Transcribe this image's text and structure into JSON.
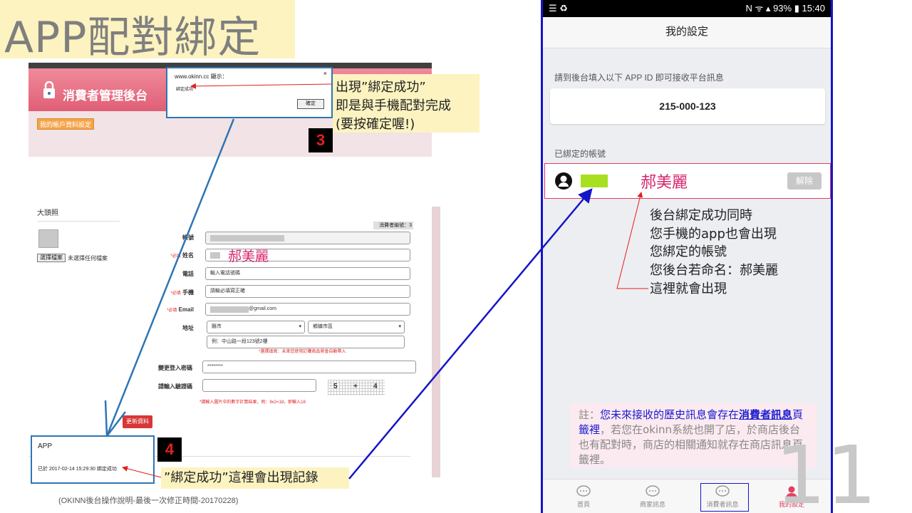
{
  "slide": {
    "title": "APP配對綁定",
    "page_number": "11",
    "footer_note": "(OKINN後台操作說明-最後一次修正時間-20170228)"
  },
  "backend": {
    "header_title": "消費者管理後台",
    "account_button": "我的帳戶資料設定",
    "dialog": {
      "host": "www.okinn.cc 顯示：",
      "message": "綁定成功",
      "close": "×",
      "ok_button": "確定"
    },
    "form": {
      "avatar_label": "大頭照",
      "file_button": "選擇檔案",
      "file_status": "未選擇任何檔案",
      "consumer_no": "消費者編號：3",
      "required_tag": "*必填",
      "fields": {
        "account_label": "帳號",
        "name_label": "姓名",
        "name_value": "郝美麗",
        "phone_label": "電話",
        "phone_placeholder": "輸入電話號碼",
        "mobile_label": "手機",
        "mobile_placeholder": "請輸必填寫正確",
        "email_label": "Email",
        "email_value": "@gmail.com",
        "address_label": "地址",
        "city_value": "縣市",
        "district_value": "鄉鎮市區",
        "street_placeholder": "例：中山路一段123號2樓",
        "address_hint": "*選擇填寫：未來您使用訂購商品將會自動帶入",
        "password_label": "變更登入密碼",
        "password_value": "********",
        "captcha_label": "請輸入驗證碼",
        "captcha_a": "5",
        "captcha_op": "+",
        "captcha_b": "4",
        "captcha_hint": "*請輸入圖片中的數字計算結果，例：9x2=18，即輸入18"
      },
      "update_button": "更新資料"
    },
    "app_box": {
      "title": "APP",
      "log": "已於 2017-02-14 15:29:30 綁定成功"
    }
  },
  "callouts": {
    "dialog_lines": [
      "出現”綁定成功”",
      "即是與手機配對完成",
      "(要按確定喔!)"
    ],
    "step3": "3",
    "step4": "4",
    "record": "”綁定成功”這裡會出現記錄"
  },
  "phone": {
    "status_left": "☰ ♻",
    "status_right": "N ᯤ ▴ 93% ▮ 15:40",
    "app_bar_title": "我的設定",
    "appid_prompt": "請到後台填入以下 APP ID 即可接收平台訊息",
    "app_id": "215-000-123",
    "bound_label": "已綁定的帳號",
    "bound_name": "郝美麗",
    "unbind_button": "解除",
    "explain_lines": [
      "後台綁定成功同時",
      "您手機的app也會出現",
      "您綁定的帳號",
      "您後台若命名：郝美麗",
      "這裡就會出現"
    ],
    "note": {
      "prefix": "註：",
      "blue1": "您未來接收的歷史訊息會存在",
      "link": "消費者訊息",
      "blue2": "頁籤裡",
      "rest": "，若您在okinn系統也開了店，於商店後台也有配對時，商店的相關通知就存在商店訊息頁籤裡。"
    },
    "nav": [
      "首頁",
      "商家訊息",
      "消費者訊息",
      "我的設定"
    ]
  },
  "colors": {
    "accent_blue": "#2f75b5",
    "arrow_red": "#e02020",
    "phone_border": "#1515c8",
    "callout_bg": "#fcf3c0",
    "name_pink": "#d4266e"
  }
}
